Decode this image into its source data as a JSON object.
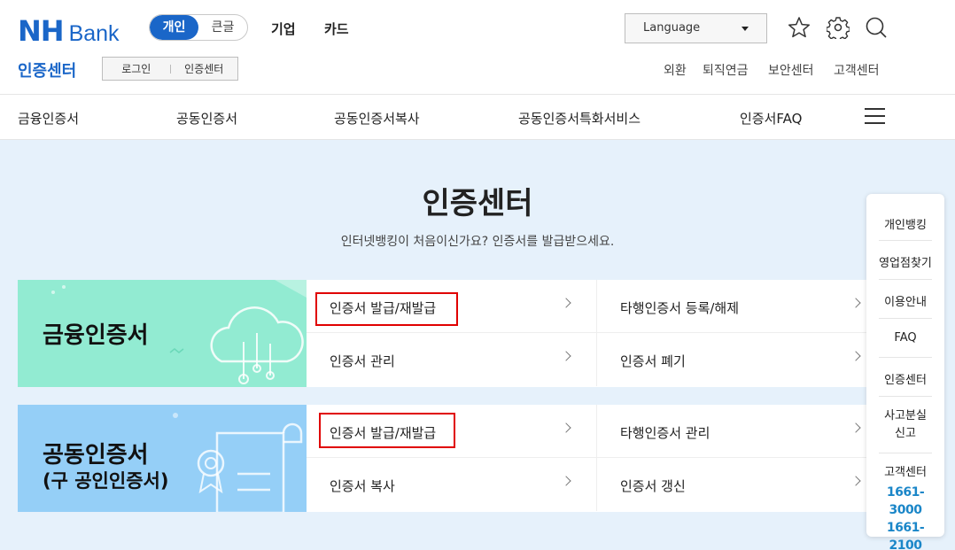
{
  "header": {
    "logo_nh": "NH",
    "logo_bank": "Bank",
    "mode_personal": "개인",
    "mode_bigtext": "큰글",
    "link_business": "기업",
    "link_card": "카드",
    "language_label": "Language",
    "icons": [
      "star-icon",
      "gear-icon",
      "search-icon"
    ]
  },
  "subheader": {
    "title": "인증센터",
    "login": "로그인",
    "cert_center": "인증센터",
    "links": [
      "외환",
      "퇴직연금",
      "보안센터",
      "고객센터"
    ]
  },
  "nav": {
    "items": [
      "금융인증서",
      "공동인증서",
      "공동인증서복사",
      "공동인증서특화서비스",
      "인증서FAQ"
    ],
    "menu_icon": "hamburger-icon"
  },
  "main": {
    "title": "인증센터",
    "subtitle": "인터넷뱅킹이 처음이신가요? 인증서를 발급받으세요."
  },
  "cards": [
    {
      "title": "금융인증서",
      "color": "#92ebd2",
      "links": [
        "인증서 발급/재발급",
        "타행인증서 등록/해제",
        "인증서 관리",
        "인증서 폐기"
      ]
    },
    {
      "title": "공동인증서",
      "subtitle": "(구 공인인증서)",
      "color": "#95cff7",
      "links": [
        "인증서 발급/재발급",
        "타행인증서 관리",
        "인증서 복사",
        "인증서 갱신"
      ]
    }
  ],
  "quick_menu": {
    "items": [
      "개인뱅킹",
      "영업점찾기",
      "이용안내",
      "FAQ",
      "인증센터"
    ],
    "loss_line1": "사고분실",
    "loss_line2": "신고",
    "customer_center": "고객센터",
    "tel1": "1661-3000",
    "tel2": "1661-2100"
  },
  "colors": {
    "brand_blue": "#1a66c8",
    "highlight_red": "#e00000",
    "content_bg": "#e6f1fb"
  }
}
